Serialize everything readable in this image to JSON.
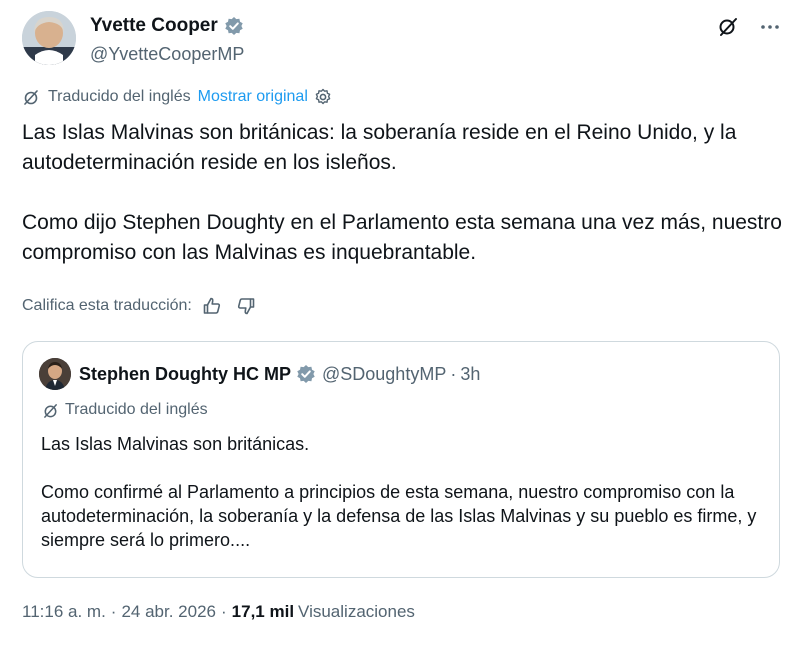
{
  "author": {
    "display_name": "Yvette Cooper",
    "handle": "@YvetteCooperMP",
    "verified": true
  },
  "translation": {
    "label": "Traducido del inglés",
    "show_original": "Mostrar original"
  },
  "tweet": {
    "paragraphs": [
      "Las Islas Malvinas son británicas: la soberanía reside en el Reino Unido, y la autodeterminación reside en los isleños.",
      "Como dijo Stephen Doughty en el Parlamento esta semana una vez más, nuestro compromiso con las Malvinas es inquebrantable."
    ]
  },
  "rate": {
    "label": "Califica esta traducción:"
  },
  "quoted": {
    "display_name": "Stephen Doughty HC MP",
    "handle": "@SDoughtyMP",
    "separator": "·",
    "time": "3h",
    "translated_label": "Traducido del inglés",
    "paragraphs": [
      "Las Islas Malvinas son británicas.",
      "Como confirmé al Parlamento a principios de esta semana, nuestro compromiso con la autodeterminación, la soberanía y la defensa de las Islas Malvinas y su pueblo es firme, y siempre será lo primero...."
    ]
  },
  "meta": {
    "time": "11:16 a. m.",
    "date": "24 abr. 2026",
    "separator": "·",
    "views_count": "17,1 mil",
    "views_label": "Visualizaciones"
  },
  "colors": {
    "accent": "#1d9bf0",
    "muted": "#536471",
    "text": "#0f1419",
    "border": "#cfd9de"
  },
  "icons": {
    "verified": "verified-badge-icon",
    "grok": "grok-icon",
    "more": "more-icon",
    "translate": "translate-icon",
    "settings": "gear-icon",
    "like": "thumbs-up-icon",
    "dislike": "thumbs-down-icon"
  }
}
